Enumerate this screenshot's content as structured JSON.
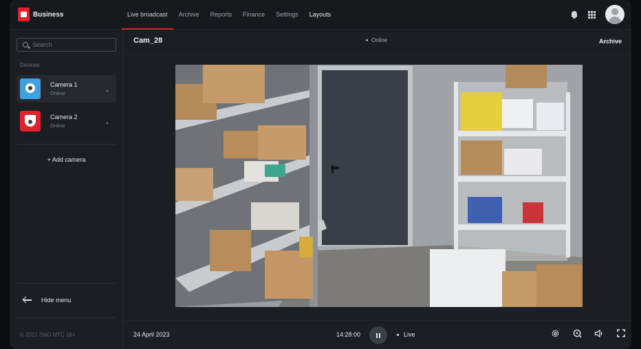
{
  "brand": {
    "name": "Business",
    "color": "#e1222b"
  },
  "nav": {
    "items": [
      {
        "label": "Live broadcast",
        "active": true
      },
      {
        "label": "Archive"
      },
      {
        "label": "Reports"
      },
      {
        "label": "Finance"
      },
      {
        "label": "Settings"
      },
      {
        "label": "Layouts"
      }
    ]
  },
  "header_icons": [
    "bell-icon",
    "apps-grid-icon",
    "user-avatar"
  ],
  "sidebar": {
    "search_placeholder": "Search",
    "devices_label": "Devices",
    "devices": [
      {
        "name": "Camera 1",
        "status": "Online",
        "icon": "camera-dome-icon",
        "color": "#3ea1e0"
      },
      {
        "name": "Camera 2",
        "status": "Online",
        "icon": "camera-bullet-icon",
        "color": "#e1222b"
      }
    ],
    "add_camera": "+ Add camera",
    "hide_menu": "Hide menu",
    "copyright": "© 2021 ПАО МТС 18+"
  },
  "main": {
    "camera_title": "Cam_28",
    "status": "Online",
    "archive_label": "Archive"
  },
  "player": {
    "date": "24 April 2023",
    "time": "14:28:00",
    "live_label": "Live",
    "controls": [
      "settings-icon",
      "zoom-icon",
      "volume-icon",
      "fullscreen-icon"
    ]
  }
}
